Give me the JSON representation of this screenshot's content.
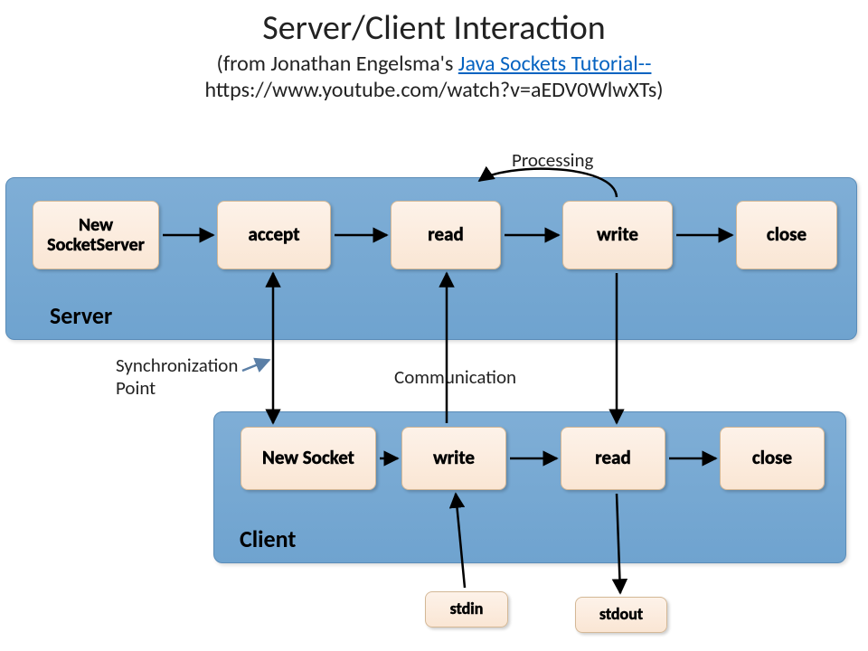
{
  "header": {
    "title": "Server/Client Interaction",
    "subtitle_prefix": "(from Jonathan Engelsma's ",
    "subtitle_link": "Java Sockets Tutorial--",
    "url": "https://www.youtube.com/watch?v=aEDV0WlwXTs)"
  },
  "panels": {
    "server_label": "Server",
    "client_label": "Client"
  },
  "server_nodes": {
    "new_socket_server": "New SocketServer",
    "accept": "accept",
    "read": "read",
    "write": "write",
    "close": "close"
  },
  "client_nodes": {
    "new_socket": "New Socket",
    "write": "write",
    "read": "read",
    "close": "close"
  },
  "io_nodes": {
    "stdin": "stdin",
    "stdout": "stdout"
  },
  "labels": {
    "processing": "Processing",
    "synchronization": "Synchronization\nPoint",
    "communication": "Communication"
  },
  "colors": {
    "panel": "#6fa3cf",
    "node": "#fae6d4",
    "link": "#0563c1"
  }
}
